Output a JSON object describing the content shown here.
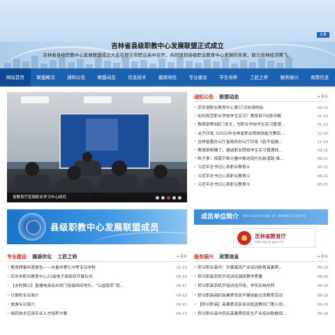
{
  "header": {
    "lang_button": "头条",
    "title": "吉林省县级职教中心发展联盟正式成立",
    "subtitle": "吉林省县级职教中心发展联盟成立大会在舒兰市职业高中召开，共同谋划县级职业教育中心发展的未来，助力吉林经济腾飞。"
  },
  "nav": {
    "items": [
      "网站首页",
      "联盟概况",
      "通知公告",
      "联盟动态",
      "信息技术",
      "摄源培优",
      "专业建设",
      "学生培养",
      "工匠之师",
      "服务振兴",
      "政策信息"
    ]
  },
  "carousel": {
    "caption": "省教育厅莅临职业学习中心研究",
    "dot_count": 5,
    "active_dot": 3
  },
  "notice": {
    "title1": "通知公告",
    "sep": "·",
    "title2": "联盟动态",
    "more": "更多",
    "items": [
      {
        "text": "农安县职业教育中心第37次协调例会",
        "date": "09-13"
      },
      {
        "text": "如何规范职业学校学生实习？教育部7问答详解",
        "date": "01-22"
      },
      {
        "text": "教育部等8部门发文，为职业学校学生实习管理...",
        "date": "01-22"
      },
      {
        "text": "关于印发《2022年吉林省职业院校技能大赛实...",
        "date": "12-20"
      },
      {
        "text": "吉林省委办公厅省政府办公厅印发《若干措施...",
        "date": "11-10"
      },
      {
        "text": "教育部明确了，遴选职业院校学生实习管理规...",
        "date": "08-21"
      },
      {
        "text": "陈子季：按需不断分量中推进现代化新道路 推...",
        "date": "08-21"
      },
      {
        "text": "习近平总书记心系职业教育②",
        "date": "08-21"
      },
      {
        "text": "习近平总书记心系职业教育①",
        "date": "08-21"
      },
      {
        "text": "习近平总书记心系职业教育③",
        "date": "08-21"
      }
    ]
  },
  "banner": {
    "text": "县级职教中心发展联盟成员"
  },
  "unit": {
    "title": "成员单位简介",
    "subtitle": "INTRODUCTION OF MEMBER UNITS"
  },
  "edu": {
    "name": "吉林省教育厅",
    "url": "http://jyt.jl.gov.cn/"
  },
  "left_list": {
    "title1": "专业建设",
    "sep1": "·",
    "title2": "摄源优化",
    "sep2": "·",
    "title3": "工匠之师",
    "more": "更多",
    "items": [
      {
        "text": "教育质量年度报告——长春市第七中等专业学校",
        "date": "11-10"
      },
      {
        "text": "四平市职业教育中心21级电子商务班开展仪式",
        "date": "09-22"
      },
      {
        "text": "【乡村振兴】直播电商走出校门连接田间地头，“公益助农”助...",
        "date": "09-22"
      },
      {
        "text": "计算机专业简介",
        "date": "09-22"
      },
      {
        "text": "旅游专业简介",
        "date": "09-22"
      },
      {
        "text": "制药技术应用专业人才培养方案",
        "date": "09-22"
      }
    ]
  },
  "right_list": {
    "title1": "服务振兴",
    "sep1": "·",
    "title2": "政策信息",
    "more": "更多",
    "items": [
      {
        "text": "舒兰职业高中：开展蛋鸡产业培训助育高素质...",
        "date": "09-19"
      },
      {
        "text": "舒兰职高农机手培训班调研教学质量",
        "date": "09-19"
      },
      {
        "text": "舒兰职高农机手培训班开班，学员反映热烈",
        "date": "09-19"
      },
      {
        "text": "舒兰职高组织高素质农民开展技能交流教育活动",
        "date": "09-19"
      },
      {
        "text": "【舒兰职高】高素质农民培训班送教到门第入田...",
        "date": "09-19"
      },
      {
        "text": "舒兰职业高中农民高素质农民生产业培训助推田...",
        "date": "09-19"
      }
    ]
  }
}
